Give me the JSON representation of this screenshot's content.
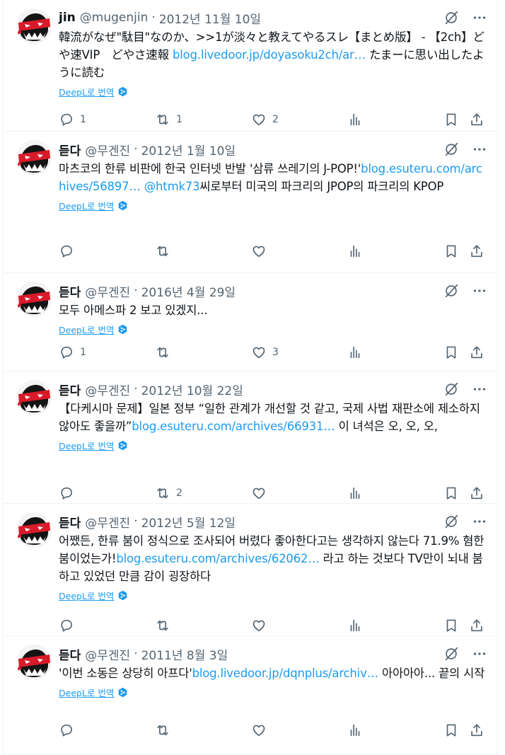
{
  "translate_label": "DeepL로 번역",
  "tweets": [
    {
      "name": "jin",
      "handle": "@mugenjin",
      "date": "2012년 11월 10일",
      "text_parts": [
        "韓流がなぜ\"駄目\"なのか、>>1が淡々と教えてやるスレ【まとめ版】 - 【2ch】どや速VIP　どやさ速報 ",
        "blog.livedoor.jp/doyasoku2ch/ar…",
        "  たまーに思い出したように読む"
      ],
      "replies": "1",
      "retweets": "1",
      "likes": "2"
    },
    {
      "name": "듣다",
      "handle": "@무겐진",
      "date": "2012년 1월 10일",
      "text_parts": [
        "마츠코의 한류 비판에 한국 인터넷 반발 '삼류 쓰레기의 J-POP!'",
        "blog.esuteru.com/archives/56897…",
        " ",
        "@htmk73",
        "씨로부터 미국의 파크리의 JPOP의 파크리의 KPOP"
      ],
      "replies": "",
      "retweets": "",
      "likes": ""
    },
    {
      "name": "듣다",
      "handle": "@무겐진",
      "date": "2016년 4월 29일",
      "text_parts": [
        "모두 아메스파 2 보고 있겠지..."
      ],
      "replies": "1",
      "retweets": "",
      "likes": "3"
    },
    {
      "name": "듣다",
      "handle": "@무겐진",
      "date": "2012년 10월 22일",
      "text_parts": [
        "【다케시마 문제】일본 정부 “일한 관계가 개선할 것 같고, 국제 사법 재판소에 제소하지 않아도 좋을까”",
        "blog.esuteru.com/archives/66931…",
        "          이 녀석은 오, 오, 오,"
      ],
      "replies": "",
      "retweets": "2",
      "likes": ""
    },
    {
      "name": "듣다",
      "handle": "@무겐진",
      "date": "2012년 5월 12일",
      "text_parts": [
        "어쨌든, 한류 붐이 정식으로 조사되어 버렸다 좋아한다고는 생각하지 않는다 71.9% 혐한 붐이었는가!",
        "blog.esuteru.com/archives/62062…",
        "    라고 하는 것보다 TV만이 뇌내 붐 하고 있었던 만큼 감이 굉장하다"
      ],
      "replies": "",
      "retweets": "",
      "likes": ""
    },
    {
      "name": "듣다",
      "handle": "@무겐진",
      "date": "2011년 8월 3일",
      "text_parts": [
        "'이번 소동은 상당히 아프다'",
        "blog.livedoor.jp/dqnplus/archiv…",
        "    아아아아... 끝의 시작"
      ],
      "replies": "",
      "retweets": "",
      "likes": ""
    }
  ]
}
